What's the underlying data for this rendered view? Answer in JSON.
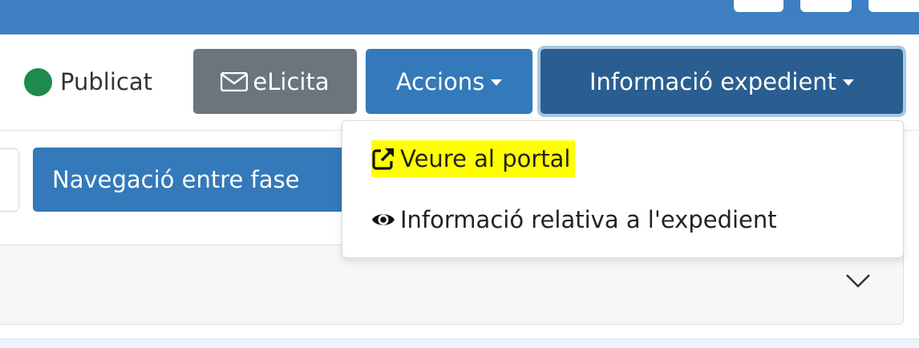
{
  "header": {
    "status_label": "Publicat",
    "status_color": "#1e8a4e",
    "elicita_label": "eLicita",
    "accions_label": "Accions",
    "info_label": "Informació expedient"
  },
  "toolbar": {
    "nav_label": "Navegació entre fase"
  },
  "dropdown": {
    "items": [
      {
        "label": "Veure al portal",
        "icon": "external-link-icon",
        "highlight": "#ffff00"
      },
      {
        "label": "Informació relativa a l'expedient",
        "icon": "eye-icon"
      }
    ]
  },
  "icons": {
    "elicita": "envelope-icon",
    "panel_toggle": "chevron-down-icon"
  },
  "colors": {
    "primary": "#3479b9",
    "primary_dark": "#2a5e90",
    "secondary": "#6c757d",
    "navbar": "#3d7fc1"
  }
}
